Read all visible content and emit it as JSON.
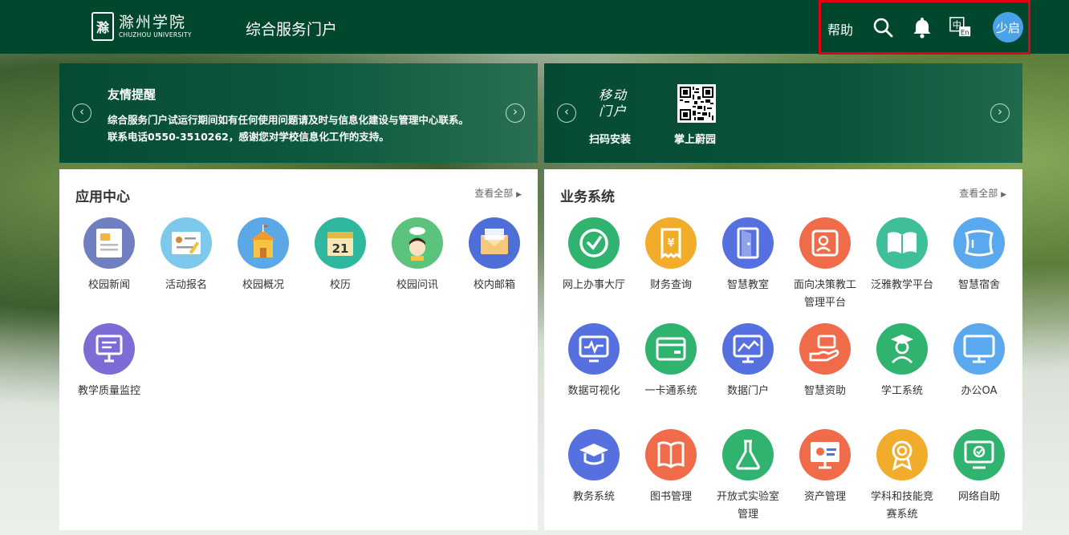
{
  "header": {
    "logo_cn": "滁州学院",
    "logo_en": "CHUZHOU UNIVERSITY",
    "portal_title": "综合服务门户",
    "help": "帮助",
    "lang_icon": "中En",
    "avatar": "少启"
  },
  "notice": {
    "title": "友情提醒",
    "line1": "综合服务门户试运行期间如有任何使用问题请及时与信息化建设与管理中心联系。",
    "line2": "联系电话0550-3510262，感谢您对学校信息化工作的支持。"
  },
  "mobile": {
    "tag": "移动门户",
    "scan_label": "扫码安装",
    "app_label": "掌上蔚园"
  },
  "app_center": {
    "title": "应用中心",
    "view_all": "查看全部",
    "items": [
      {
        "label": "校园新闻",
        "color": "#6f7fbf",
        "icon": "newspaper-icon"
      },
      {
        "label": "活动报名",
        "color": "#7ec8ec",
        "icon": "signup-form-icon"
      },
      {
        "label": "校园概况",
        "color": "#5aa9e6",
        "icon": "campus-building-icon"
      },
      {
        "label": "校历",
        "color": "#2fb7a0",
        "icon": "calendar-icon"
      },
      {
        "label": "校园问讯",
        "color": "#5bc37c",
        "icon": "student-avatar-icon"
      },
      {
        "label": "校内邮箱",
        "color": "#4f6fd8",
        "icon": "mail-icon"
      },
      {
        "label": "教学质量监控",
        "color": "#7b6cd6",
        "icon": "presentation-board-icon"
      }
    ]
  },
  "business": {
    "title": "业务系统",
    "view_all": "查看全部",
    "items": [
      {
        "label": "网上办事大厅",
        "color": "#2fb36f",
        "icon": "check-circle-icon"
      },
      {
        "label": "财务查询",
        "color": "#f2ac2b",
        "icon": "receipt-yen-icon"
      },
      {
        "label": "智慧教室",
        "color": "#5670e0",
        "icon": "door-icon"
      },
      {
        "label": "面向决策教工管理平台",
        "color": "#ef6b4a",
        "icon": "profile-card-icon"
      },
      {
        "label": "泛雅教学平台",
        "color": "#3fbf99",
        "icon": "open-book-icon"
      },
      {
        "label": "智慧宿舍",
        "color": "#5aa9ee",
        "icon": "pillow-icon"
      },
      {
        "label": "数据可视化",
        "color": "#5670e0",
        "icon": "pulse-monitor-icon"
      },
      {
        "label": "一卡通系统",
        "color": "#2fb36f",
        "icon": "card-icon"
      },
      {
        "label": "数据门户",
        "color": "#5670e0",
        "icon": "line-chart-monitor-icon"
      },
      {
        "label": "智慧资助",
        "color": "#ef6b4a",
        "icon": "hand-money-icon"
      },
      {
        "label": "学工系统",
        "color": "#2fb36f",
        "icon": "graduate-icon"
      },
      {
        "label": "办公OA",
        "color": "#5aa9ee",
        "icon": "desktop-icon"
      },
      {
        "label": "教务系统",
        "color": "#5670e0",
        "icon": "mortarboard-icon"
      },
      {
        "label": "图书管理",
        "color": "#ef6b4a",
        "icon": "book-icon"
      },
      {
        "label": "开放式实验室管理",
        "color": "#2fb36f",
        "icon": "flask-icon"
      },
      {
        "label": "资产管理",
        "color": "#ef6b4a",
        "icon": "asset-screen-icon"
      },
      {
        "label": "学科和技能竞赛系统",
        "color": "#f2ac2b",
        "icon": "award-medal-icon"
      },
      {
        "label": "网络自助",
        "color": "#2fb36f",
        "icon": "network-monitor-icon"
      }
    ]
  }
}
